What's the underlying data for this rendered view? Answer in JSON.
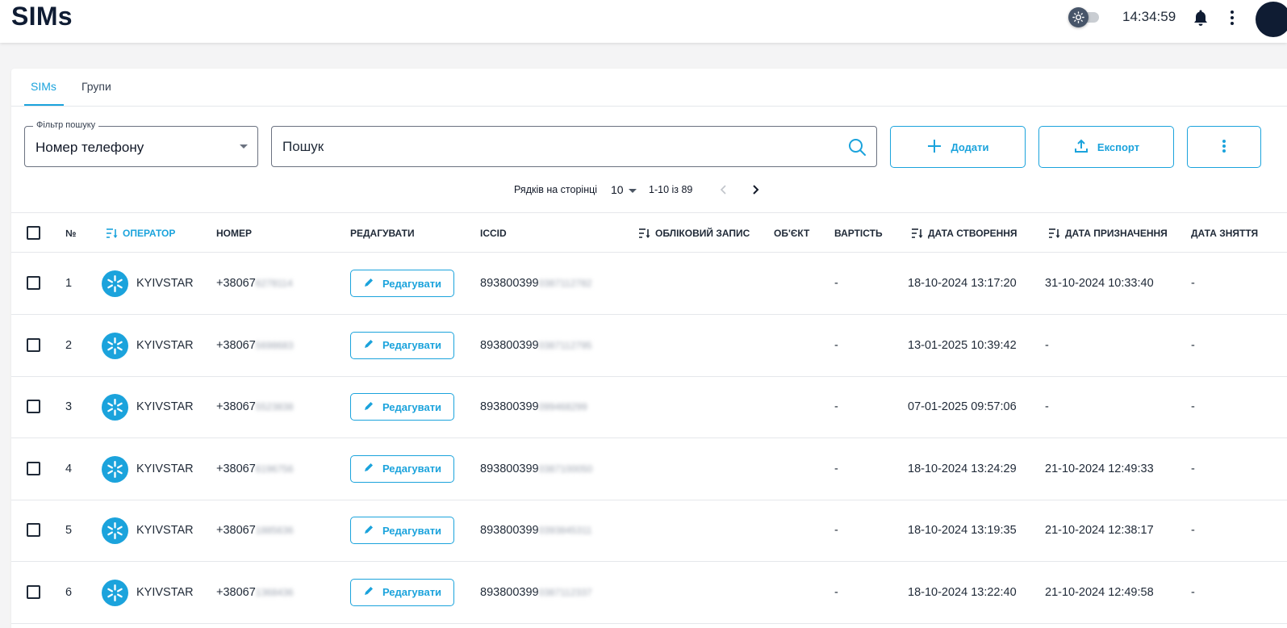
{
  "header": {
    "title": "SIMs",
    "time": "14:34:59"
  },
  "tabs": [
    {
      "label": "SIMs",
      "active": true
    },
    {
      "label": "Групи",
      "active": false
    }
  ],
  "toolbar": {
    "filter_legend": "Фільтр пошуку",
    "filter_value": "Номер телефону",
    "search_placeholder": "Пошук",
    "add_label": "Додати",
    "export_label": "Експорт"
  },
  "pagination": {
    "rows_label": "Рядків на сторінці",
    "rows_value": "10",
    "range": "1-10 із 89"
  },
  "columns": {
    "num": "№",
    "operator": "ОПЕРАТОР",
    "number": "НОМЕР",
    "edit": "РЕДАГУВАТИ",
    "iccid": "ICCID",
    "account": "ОБЛІКОВИЙ ЗАПИС",
    "object": "ОБ'ЄКТ",
    "cost": "ВАРТІСТЬ",
    "created": "ДАТА СТВОРЕННЯ",
    "assigned": "ДАТА ПРИЗНАЧЕННЯ",
    "removed": "ДАТА ЗНЯТТЯ"
  },
  "edit_label": "Редагувати",
  "rows": [
    {
      "num": "1",
      "operator": "KYIVSTAR",
      "number_prefix": "+38067",
      "number_hidden": "6278114",
      "iccid_prefix": "893800399",
      "iccid_hidden": "0387112782",
      "cost": "-",
      "created": "18-10-2024 13:17:20",
      "assigned": "31-10-2024 10:33:40",
      "removed": "-"
    },
    {
      "num": "2",
      "operator": "KYIVSTAR",
      "number_prefix": "+38067",
      "number_hidden": "5698683",
      "iccid_prefix": "893800399",
      "iccid_hidden": "0387112795",
      "cost": "-",
      "created": "13-01-2025 10:39:42",
      "assigned": "-",
      "removed": "-"
    },
    {
      "num": "3",
      "operator": "KYIVSTAR",
      "number_prefix": "+38067",
      "number_hidden": "5523838",
      "iccid_prefix": "893800399",
      "iccid_hidden": "099468299",
      "cost": "-",
      "created": "07-01-2025 09:57:06",
      "assigned": "-",
      "removed": "-"
    },
    {
      "num": "4",
      "operator": "KYIVSTAR",
      "number_prefix": "+38067",
      "number_hidden": "6196756",
      "iccid_prefix": "893800399",
      "iccid_hidden": "0387100050",
      "cost": "-",
      "created": "18-10-2024 13:24:29",
      "assigned": "21-10-2024 12:49:33",
      "removed": "-"
    },
    {
      "num": "5",
      "operator": "KYIVSTAR",
      "number_prefix": "+38067",
      "number_hidden": "1885636",
      "iccid_prefix": "893800399",
      "iccid_hidden": "0393845311",
      "cost": "-",
      "created": "18-10-2024 13:19:35",
      "assigned": "21-10-2024 12:38:17",
      "removed": "-"
    },
    {
      "num": "6",
      "operator": "KYIVSTAR",
      "number_prefix": "+38067",
      "number_hidden": "1368436",
      "iccid_prefix": "893800399",
      "iccid_hidden": "0387112337",
      "cost": "-",
      "created": "18-10-2024 13:22:40",
      "assigned": "21-10-2024 12:49:58",
      "removed": "-"
    }
  ],
  "colors": {
    "accent": "#1ba3dc",
    "text": "#1f2937",
    "navy": "#0f1c33"
  }
}
